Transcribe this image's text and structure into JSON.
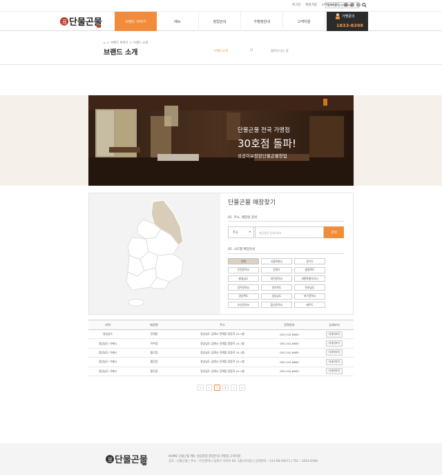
{
  "util": {
    "links": [
      "로그인",
      "회원가입",
      "LANGUAGE"
    ],
    "search_placeholder": "검색어를 입력해주세요"
  },
  "header": {
    "nav": [
      "브랜드 이야기",
      "메뉴",
      "창업안내",
      "가맹점안내",
      "고객지원"
    ],
    "cs_label": "가맹문의",
    "cs_phone": "1833-8398"
  },
  "page": {
    "breadcrumb": [
      "브랜드 이야기",
      "브랜드 소개"
    ],
    "title": "브랜드 소개",
    "subnav": [
      "브랜드소개",
      "CI",
      "찾아오시는 길"
    ]
  },
  "banner": {
    "line1": "단물곤물 전국 가맹점",
    "line2": "30호점 돌파!",
    "line3": "성공이보장된단물곤물창업"
  },
  "finder": {
    "title": "단물곤물 매장찾기",
    "section1": "01. 주소, 매장명 검색",
    "select_value": "주소",
    "input_placeholder": "매장명을 입력하세요",
    "find_button": "검색",
    "section2": "02. 시도별 매장안내",
    "regions": [
      "전체",
      "서울특별시",
      "경기도",
      "인천광역시",
      "강원도",
      "충청북도",
      "충청남도",
      "대전광역시",
      "세종특별자치시",
      "광주광역시",
      "전라북도",
      "전라남도",
      "경상북도",
      "경상남도",
      "대구광역시",
      "부산광역시",
      "울산광역시",
      "제주도"
    ]
  },
  "table": {
    "headers": [
      "지역",
      "매장명",
      "주소",
      "전화번호",
      "상세보기"
    ],
    "rows": [
      [
        "경상남도",
        "진례점",
        "경상남도 김해시 진례읍 장동로 24-1층",
        "055-342-6663",
        "자세히보기"
      ],
      [
        "경상남도 거제시",
        "아주점",
        "경상남도 김해시 진례읍 장동로 24-1층",
        "055-342-6663",
        "자세히보기"
      ],
      [
        "경상남도 거제시",
        "월무점",
        "경상남도 김해시 진례읍 장동로 24-1층",
        "055-342-6663",
        "자세히보기"
      ],
      [
        "경상남도 거제시",
        "월무점",
        "경상남도 김해시 진례읍 장동로 24-1층",
        "055-342-6663",
        "자세히보기"
      ],
      [
        "경상남도 거제시",
        "월무점",
        "경상남도 김해시 진례읍 장동로 24-1층",
        "055-342-6663",
        "자세히보기"
      ]
    ]
  },
  "pager": [
    "«",
    "‹",
    "1",
    "2",
    "›",
    "»"
  ],
  "footer": {
    "links": "HOME 단물곤물 메뉴 성공창업 창업안내 가맹점 고객지원",
    "info": "상호 : 단물곤물 | 주소 : 부산광역시 동래구 사직로 60, 1층(사직동) | 등록번호 : 143-08-00071 | TEL : 1833-8398"
  },
  "colors": {
    "accent": "#f08c3c",
    "dark": "#2b2b2b"
  }
}
